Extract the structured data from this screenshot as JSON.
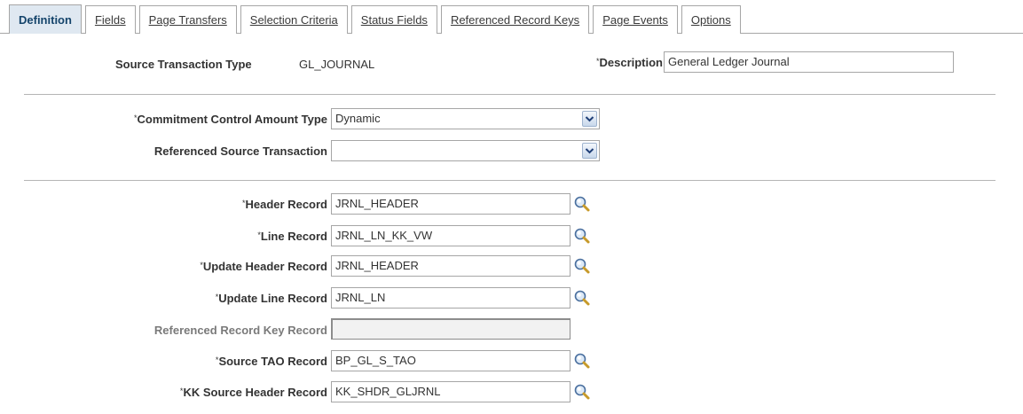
{
  "tabs": [
    {
      "label": "Definition",
      "active": true
    },
    {
      "label": "Fields",
      "active": false
    },
    {
      "label": "Page Transfers",
      "active": false
    },
    {
      "label": "Selection Criteria",
      "active": false
    },
    {
      "label": "Status Fields",
      "active": false
    },
    {
      "label": "Referenced Record Keys",
      "active": false
    },
    {
      "label": "Page Events",
      "active": false
    },
    {
      "label": "Options",
      "active": false
    }
  ],
  "required_marker": "*",
  "source_transaction_type": {
    "label": "Source Transaction Type",
    "value": "GL_JOURNAL"
  },
  "description": {
    "label": "Description",
    "value": "General Ledger Journal",
    "required": true
  },
  "commitment_control_amount_type": {
    "label": "Commitment Control Amount Type",
    "value": "Dynamic",
    "required": true
  },
  "referenced_source_transaction": {
    "label": "Referenced Source Transaction",
    "value": ""
  },
  "header_record": {
    "label": "Header Record",
    "value": "JRNL_HEADER",
    "required": true
  },
  "line_record": {
    "label": "Line Record",
    "value": "JRNL_LN_KK_VW",
    "required": true
  },
  "update_header_record": {
    "label": "Update Header Record",
    "value": "JRNL_HEADER",
    "required": true
  },
  "update_line_record": {
    "label": "Update Line Record",
    "value": "JRNL_LN",
    "required": true
  },
  "referenced_record_key_record": {
    "label": "Referenced Record Key Record",
    "value": ""
  },
  "source_tao_record": {
    "label": "Source TAO Record",
    "value": "BP_GL_S_TAO",
    "required": true
  },
  "kk_source_header_record": {
    "label": "KK Source Header Record",
    "value": "KK_SHDR_GLJRNL",
    "required": true
  },
  "icons": {
    "lookup": "magnifier-lookup-icon",
    "dropdown": "chevron-down-icon"
  },
  "colors": {
    "active_tab_bg": "#dfe8f1",
    "active_tab_text": "#14446b",
    "dropdown_button": "#c8d8ec"
  }
}
